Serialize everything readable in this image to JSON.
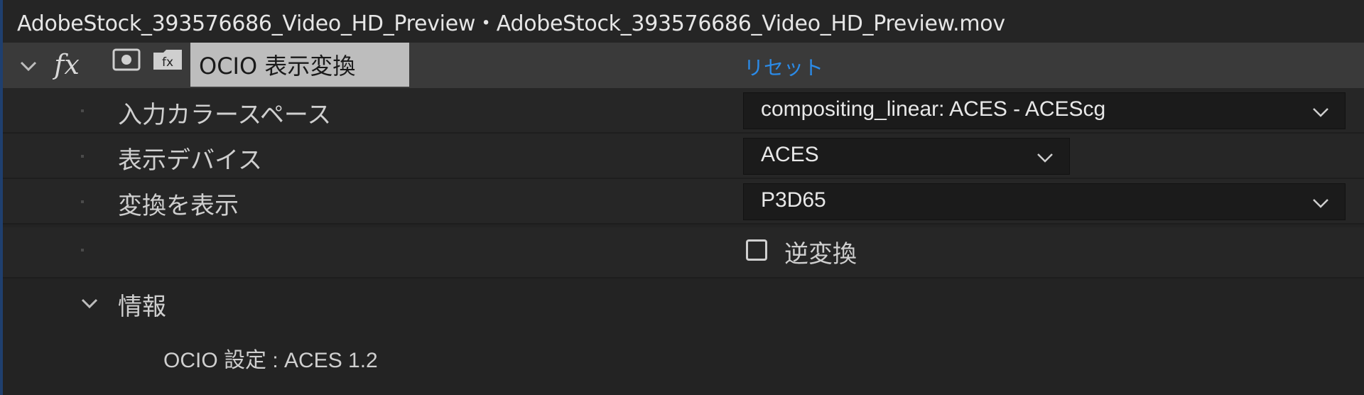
{
  "title_bar": {
    "text": "AdobeStock_393576686_Video_HD_Preview・AdobeStock_393576686_Video_HD_Preview.mov"
  },
  "effect": {
    "fx_label": "fx",
    "name": "OCIO 表示変換",
    "reset_label": "リセット",
    "expand_icon": "chevron-down-icon",
    "bypass_icon": "record-icon",
    "preset_icon": "preset-icon"
  },
  "params": [
    {
      "label": "入力カラースペース",
      "value": "compositing_linear: ACES - ACEScg"
    },
    {
      "label": "表示デバイス",
      "value": "ACES"
    },
    {
      "label": "変換を表示",
      "value": "P3D65"
    }
  ],
  "inverse": {
    "label": "逆変換",
    "checked": false
  },
  "info": {
    "title": "情報",
    "config_text": "OCIO 設定 : ACES 1.2"
  },
  "colors": {
    "accent_link": "#2b8be8",
    "header_bg": "#3a3a3a",
    "name_highlight": "#bdbdbd"
  }
}
